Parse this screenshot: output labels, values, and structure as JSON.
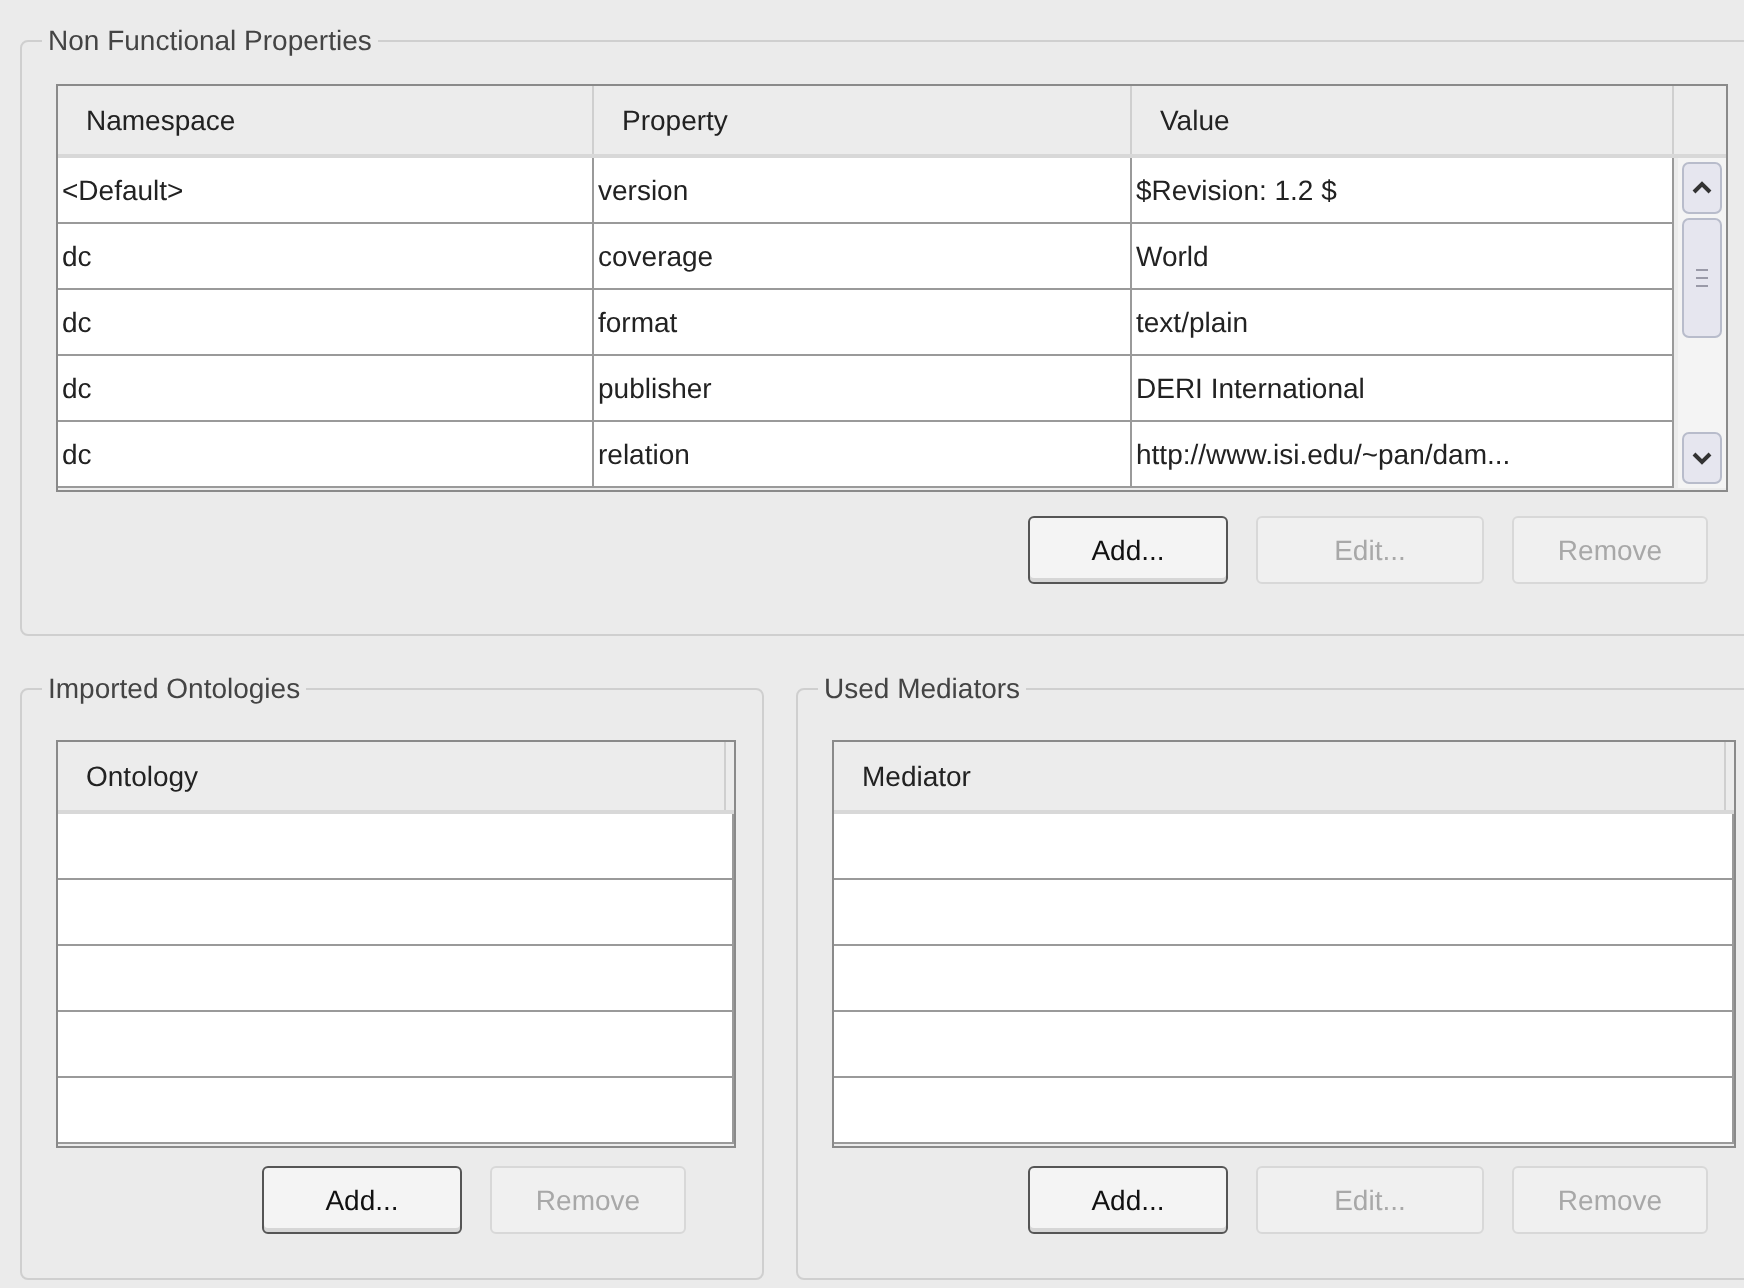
{
  "non_functional_properties": {
    "title": "Non Functional Properties",
    "table": {
      "columns": [
        "Namespace",
        "Property",
        "Value"
      ],
      "rows": [
        [
          "<Default>",
          "version",
          "$Revision: 1.2 $"
        ],
        [
          "dc",
          "coverage",
          "World"
        ],
        [
          "dc",
          "format",
          "text/plain"
        ],
        [
          "dc",
          "publisher",
          "DERI International"
        ],
        [
          "dc",
          "relation",
          "http://www.isi.edu/~pan/dam..."
        ]
      ]
    },
    "buttons": [
      {
        "label": "Add...",
        "disabled": false
      },
      {
        "label": "Edit...",
        "disabled": true
      },
      {
        "label": "Remove",
        "disabled": true
      }
    ]
  },
  "imported_ontologies": {
    "title": "Imported Ontologies",
    "table": {
      "columns": [
        "Ontology"
      ]
    },
    "buttons": [
      {
        "label": "Add...",
        "disabled": false
      },
      {
        "label": "Remove",
        "disabled": true
      }
    ]
  },
  "used_mediators": {
    "title": "Used Mediators",
    "table": {
      "columns": [
        "Mediator"
      ]
    },
    "buttons": [
      {
        "label": "Add...",
        "disabled": false
      },
      {
        "label": "Edit...",
        "disabled": true
      },
      {
        "label": "Remove",
        "disabled": true
      }
    ]
  }
}
